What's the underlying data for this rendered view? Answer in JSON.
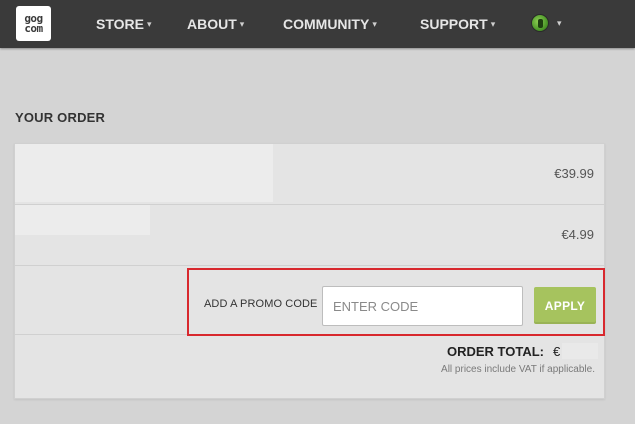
{
  "header": {
    "logo_line1": "gog",
    "logo_line2": "com",
    "nav": [
      {
        "label": "STORE"
      },
      {
        "label": "ABOUT"
      },
      {
        "label": "COMMUNITY"
      },
      {
        "label": "SUPPORT"
      }
    ],
    "chevron": "⌄",
    "avatar_icon": "user-avatar-icon"
  },
  "order": {
    "title": "YOUR ORDER",
    "items": [
      {
        "price": "€39.99"
      },
      {
        "price": "€4.99"
      }
    ],
    "promo": {
      "label": "ADD A PROMO CODE",
      "placeholder": "ENTER CODE",
      "value": "",
      "apply_label": "APPLY"
    },
    "total_label": "ORDER TOTAL:",
    "total_currency": "€",
    "vat_note": "All prices include VAT if applicable."
  },
  "colors": {
    "header_bg": "#3a3a3a",
    "page_bg": "#d4d4d4",
    "apply_button": "#a6c35e",
    "highlight_border": "#d8282e"
  }
}
